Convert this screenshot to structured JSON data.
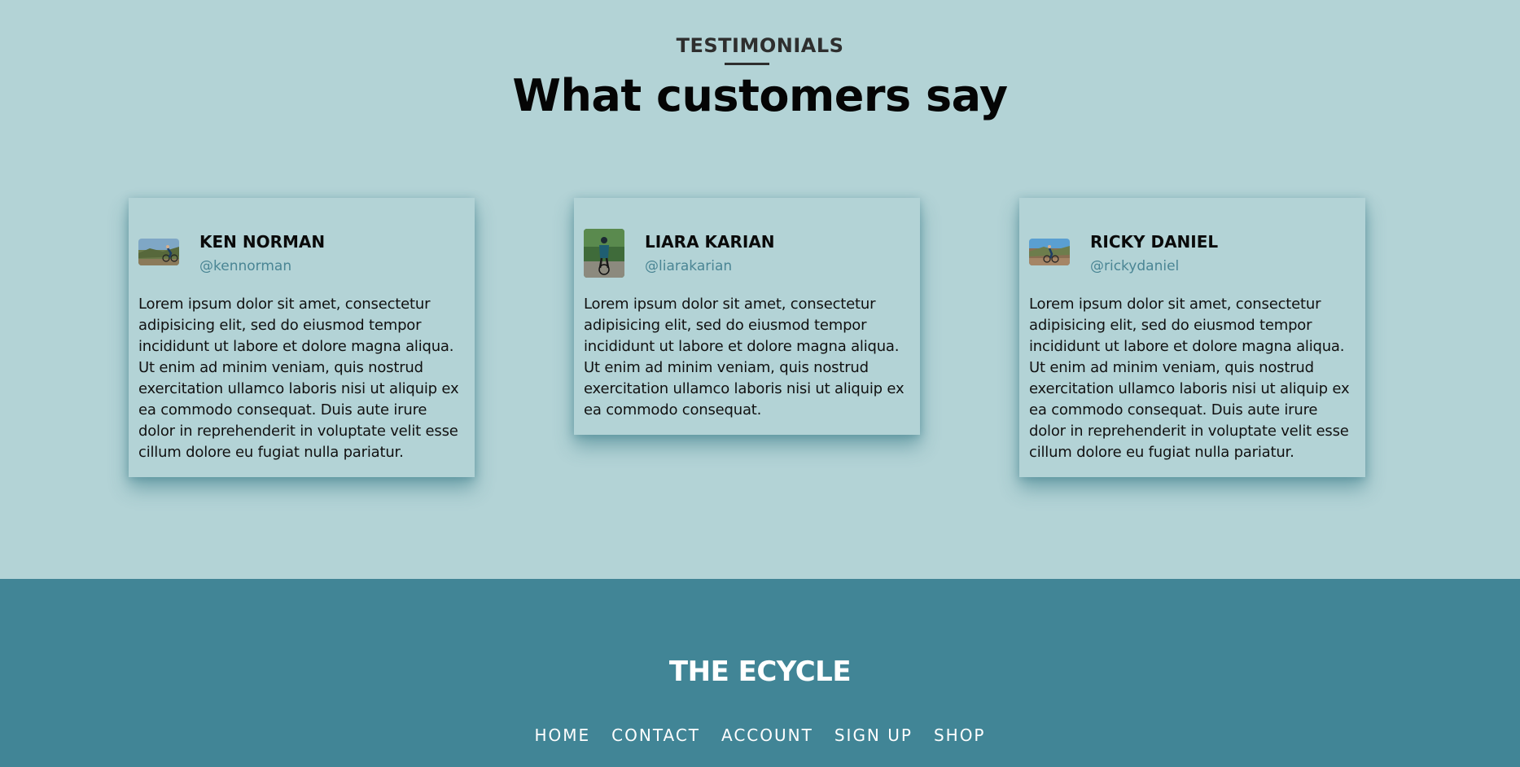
{
  "section": {
    "eyebrow": "TESTIMONIALS",
    "headline": "What customers say"
  },
  "testimonials": [
    {
      "name": "KEN NORMAN",
      "handle": "@kennorman",
      "avatar_icon": "cyclist-photo-avatar",
      "quote": "Lorem ipsum dolor sit amet, consectetur adipisicing elit, sed do eiusmod tempor incididunt ut labore et dolore magna aliqua. Ut enim ad minim veniam, quis nostrud exercitation ullamco laboris nisi ut aliquip ex ea commodo consequat. Duis aute irure dolor in reprehenderit in voluptate velit esse cillum dolore eu fugiat nulla pariatur."
    },
    {
      "name": "LIARA KARIAN",
      "handle": "@liarakarian",
      "avatar_icon": "cyclist-photo-avatar",
      "quote": "Lorem ipsum dolor sit amet, consectetur adipisicing elit, sed do eiusmod tempor incididunt ut labore et dolore magna aliqua. Ut enim ad minim veniam, quis nostrud exercitation ullamco laboris nisi ut aliquip ex ea commodo consequat."
    },
    {
      "name": "RICKY DANIEL",
      "handle": "@rickydaniel",
      "avatar_icon": "cyclist-photo-avatar",
      "quote": "Lorem ipsum dolor sit amet, consectetur adipisicing elit, sed do eiusmod tempor incididunt ut labore et dolore magna aliqua. Ut enim ad minim veniam, quis nostrud exercitation ullamco laboris nisi ut aliquip ex ea commodo consequat. Duis aute irure dolor in reprehenderit in voluptate velit esse cillum dolore eu fugiat nulla pariatur."
    }
  ],
  "footer": {
    "brand": "THE ECYCLE",
    "nav": [
      "HOME",
      "CONTACT",
      "ACCOUNT",
      "SIGN UP",
      "SHOP"
    ]
  },
  "colors": {
    "page_bg": "#b3d3d6",
    "footer_bg": "#418596",
    "handle": "#4a8594"
  }
}
